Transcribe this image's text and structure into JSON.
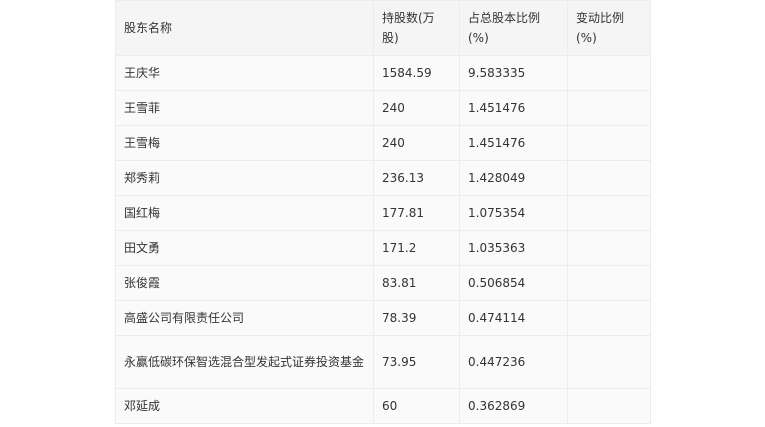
{
  "table": {
    "headers": {
      "name": "股东名称",
      "shares": "持股数(万股)",
      "ratio": "占总股本比例(%)",
      "change": "变动比例(%)"
    },
    "rows": [
      {
        "name": "王庆华",
        "shares": "1584.59",
        "ratio": "9.583335",
        "change": ""
      },
      {
        "name": "王雪菲",
        "shares": "240",
        "ratio": "1.451476",
        "change": ""
      },
      {
        "name": "王雪梅",
        "shares": "240",
        "ratio": "1.451476",
        "change": ""
      },
      {
        "name": "郑秀莉",
        "shares": "236.13",
        "ratio": "1.428049",
        "change": ""
      },
      {
        "name": "国红梅",
        "shares": "177.81",
        "ratio": "1.075354",
        "change": ""
      },
      {
        "name": "田文勇",
        "shares": "171.2",
        "ratio": "1.035363",
        "change": ""
      },
      {
        "name": "张俊霞",
        "shares": "83.81",
        "ratio": "0.506854",
        "change": ""
      },
      {
        "name": "高盛公司有限责任公司",
        "shares": "78.39",
        "ratio": "0.474114",
        "change": ""
      },
      {
        "name": "永赢低碳环保智选混合型发起式证券投资基金",
        "shares": "73.95",
        "ratio": "0.447236",
        "change": ""
      },
      {
        "name": "邓延成",
        "shares": "60",
        "ratio": "0.362869",
        "change": ""
      }
    ]
  }
}
